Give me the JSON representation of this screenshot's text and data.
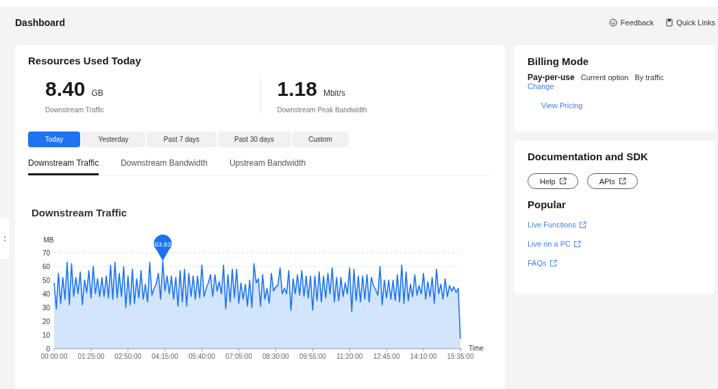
{
  "header": {
    "title": "Dashboard",
    "actions": [
      {
        "label": "Feedback",
        "kind": "feedback"
      },
      {
        "label": "Quick Links",
        "kind": "links"
      }
    ]
  },
  "resources": {
    "title": "Resources Used Today",
    "stats": [
      {
        "value": "8.40",
        "unit": "GB",
        "label": "Downstream Traffic"
      },
      {
        "value": "1.18",
        "unit": "Mbit/s",
        "label": "Downstream Peak Bandwidth"
      }
    ],
    "ranges": [
      {
        "label": "Today",
        "selected": true
      },
      {
        "label": "Yesterday",
        "selected": false
      },
      {
        "label": "Past 7 days",
        "selected": false
      },
      {
        "label": "Past 30 days",
        "selected": false
      },
      {
        "label": "Custom",
        "selected": false
      }
    ],
    "tabs": [
      {
        "label": "Downstream Traffic",
        "selected": true
      },
      {
        "label": "Downstream Bandwidth",
        "selected": false
      },
      {
        "label": "Upstream Bandwidth",
        "selected": false
      }
    ],
    "chart_title": "Downstream Traffic",
    "chart_data": {
      "type": "area",
      "xlabel": "Time",
      "ylabel": "MB",
      "xlim": [
        0,
        935
      ],
      "ylim": [
        0,
        70
      ],
      "yticks": [
        0,
        10,
        20,
        30,
        40,
        50,
        60,
        70
      ],
      "xticks": [
        {
          "value": 0,
          "label": "00:00:00"
        },
        {
          "value": 85,
          "label": "01:25:00"
        },
        {
          "value": 170,
          "label": "02:50:00"
        },
        {
          "value": 255,
          "label": "04:15:00"
        },
        {
          "value": 340,
          "label": "05:40:00"
        },
        {
          "value": 425,
          "label": "07:05:00"
        },
        {
          "value": 510,
          "label": "08:30:00"
        },
        {
          "value": 595,
          "label": "09:55:00"
        },
        {
          "value": 680,
          "label": "11:20:00"
        },
        {
          "value": 765,
          "label": "12:45:00"
        },
        {
          "value": 850,
          "label": "14:10:00"
        },
        {
          "value": 935,
          "label": "15:35:00"
        }
      ],
      "x": [
        0,
        5,
        10,
        15,
        20,
        25,
        30,
        35,
        40,
        45,
        50,
        55,
        60,
        65,
        70,
        75,
        80,
        85,
        90,
        95,
        100,
        105,
        110,
        115,
        120,
        125,
        130,
        135,
        140,
        145,
        150,
        155,
        160,
        165,
        170,
        175,
        180,
        185,
        190,
        195,
        200,
        205,
        210,
        215,
        220,
        225,
        230,
        235,
        240,
        245,
        250,
        255,
        260,
        265,
        270,
        275,
        280,
        285,
        290,
        295,
        300,
        305,
        310,
        315,
        320,
        325,
        330,
        335,
        340,
        345,
        350,
        355,
        360,
        365,
        370,
        375,
        380,
        385,
        390,
        395,
        400,
        405,
        410,
        415,
        420,
        425,
        430,
        435,
        440,
        445,
        450,
        455,
        460,
        465,
        470,
        475,
        480,
        485,
        490,
        495,
        500,
        505,
        510,
        515,
        520,
        525,
        530,
        535,
        540,
        545,
        550,
        555,
        560,
        565,
        570,
        575,
        580,
        585,
        590,
        595,
        600,
        605,
        610,
        615,
        620,
        625,
        630,
        635,
        640,
        645,
        650,
        655,
        660,
        665,
        670,
        675,
        680,
        685,
        690,
        695,
        700,
        705,
        710,
        715,
        720,
        725,
        730,
        735,
        740,
        745,
        750,
        755,
        760,
        765,
        770,
        775,
        780,
        785,
        790,
        795,
        800,
        805,
        810,
        815,
        820,
        825,
        830,
        835,
        840,
        845,
        850,
        855,
        860,
        865,
        870,
        875,
        880,
        885,
        890,
        895,
        900,
        905,
        910,
        915,
        920,
        925,
        930,
        935
      ],
      "grid": true,
      "series": [
        {
          "color": "#1a73f0",
          "values": [
            48,
            29,
            55,
            33,
            52,
            36,
            63,
            32,
            62,
            38,
            52,
            40,
            56,
            32,
            50,
            41,
            57,
            37,
            60,
            40,
            51,
            38,
            52,
            38,
            53,
            37,
            61,
            36,
            63,
            37,
            55,
            38,
            60,
            30,
            53,
            32,
            58,
            33,
            51,
            37,
            57,
            36,
            47,
            34,
            63,
            39,
            44,
            47,
            55,
            36,
            64,
            42,
            53,
            40,
            53,
            36,
            52,
            31,
            57,
            34,
            58,
            31,
            55,
            38,
            53,
            36,
            53,
            37,
            61,
            38,
            44,
            48,
            54,
            38,
            54,
            42,
            49,
            40,
            61,
            29,
            54,
            34,
            58,
            37,
            58,
            33,
            48,
            36,
            47,
            31,
            50,
            30,
            62,
            48,
            51,
            31,
            54,
            36,
            44,
            33,
            55,
            42,
            45,
            46,
            59,
            40,
            44,
            40,
            57,
            28,
            51,
            40,
            54,
            39,
            57,
            38,
            53,
            37,
            53,
            28,
            53,
            35,
            56,
            34,
            53,
            37,
            55,
            40,
            59,
            34,
            52,
            35,
            52,
            38,
            48,
            40,
            59,
            27,
            58,
            35,
            53,
            34,
            53,
            36,
            54,
            34,
            52,
            46,
            43,
            39,
            60,
            32,
            50,
            37,
            50,
            36,
            50,
            35,
            54,
            34,
            61,
            33,
            56,
            35,
            47,
            38,
            54,
            39,
            46,
            40,
            55,
            36,
            49,
            38,
            52,
            33,
            58,
            40,
            47,
            36,
            51,
            38,
            46,
            42,
            45,
            41,
            44,
            7
          ]
        }
      ],
      "annotations": [
        {
          "text": "63.93"
        }
      ]
    }
  },
  "billing": {
    "title": "Billing Mode",
    "mode": "Pay-per-use",
    "status": "Current option",
    "basis": "By traffic",
    "change_link": "Change",
    "pricing_link": "View Pricing"
  },
  "docs": {
    "title": "Documentation and SDK",
    "buttons": [
      "Help",
      "APIs"
    ],
    "popular_title": "Popular",
    "links": [
      "Live Functions",
      "Live on a PC",
      "FAQs"
    ]
  }
}
